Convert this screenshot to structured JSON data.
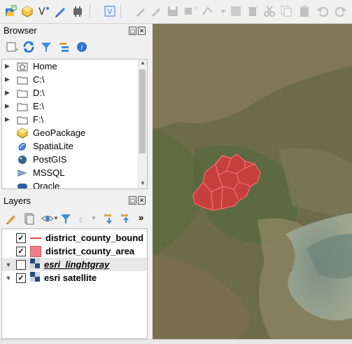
{
  "browser": {
    "title": "Browser",
    "items": [
      {
        "label": "Home",
        "icon": "home-folder-icon",
        "expandable": true
      },
      {
        "label": "C:\\",
        "icon": "folder-icon",
        "expandable": true
      },
      {
        "label": "D:\\",
        "icon": "folder-icon",
        "expandable": true
      },
      {
        "label": "E:\\",
        "icon": "folder-icon",
        "expandable": true
      },
      {
        "label": "F:\\",
        "icon": "folder-icon",
        "expandable": true
      },
      {
        "label": "GeoPackage",
        "icon": "geopackage-icon",
        "expandable": false
      },
      {
        "label": "SpatiaLite",
        "icon": "spatialite-icon",
        "expandable": false
      },
      {
        "label": "PostGIS",
        "icon": "postgis-icon",
        "expandable": false
      },
      {
        "label": "MSSQL",
        "icon": "mssql-icon",
        "expandable": false
      },
      {
        "label": "Oracle",
        "icon": "oracle-icon",
        "expandable": false
      }
    ]
  },
  "layers": {
    "title": "Layers",
    "more": "»",
    "items": [
      {
        "label": "district_county_bound",
        "checked": true,
        "icon": "line-symbol-icon",
        "italic": false,
        "expandable": false
      },
      {
        "label": "district_county_area",
        "checked": true,
        "icon": "fill-symbol-icon",
        "italic": false,
        "expandable": false
      },
      {
        "label": "esri_linghtgray",
        "checked": false,
        "icon": "raster-tile-icon",
        "italic": true,
        "expandable": true
      },
      {
        "label": "esri satellite",
        "checked": true,
        "icon": "raster-tile-icon",
        "italic": false,
        "expandable": true
      }
    ]
  },
  "colors": {
    "boundary_line": "#e8474a",
    "area_fill": "#f07f8a",
    "selection_bg": "#e8e8e8",
    "map_polygon_fill": "#e0353b"
  }
}
